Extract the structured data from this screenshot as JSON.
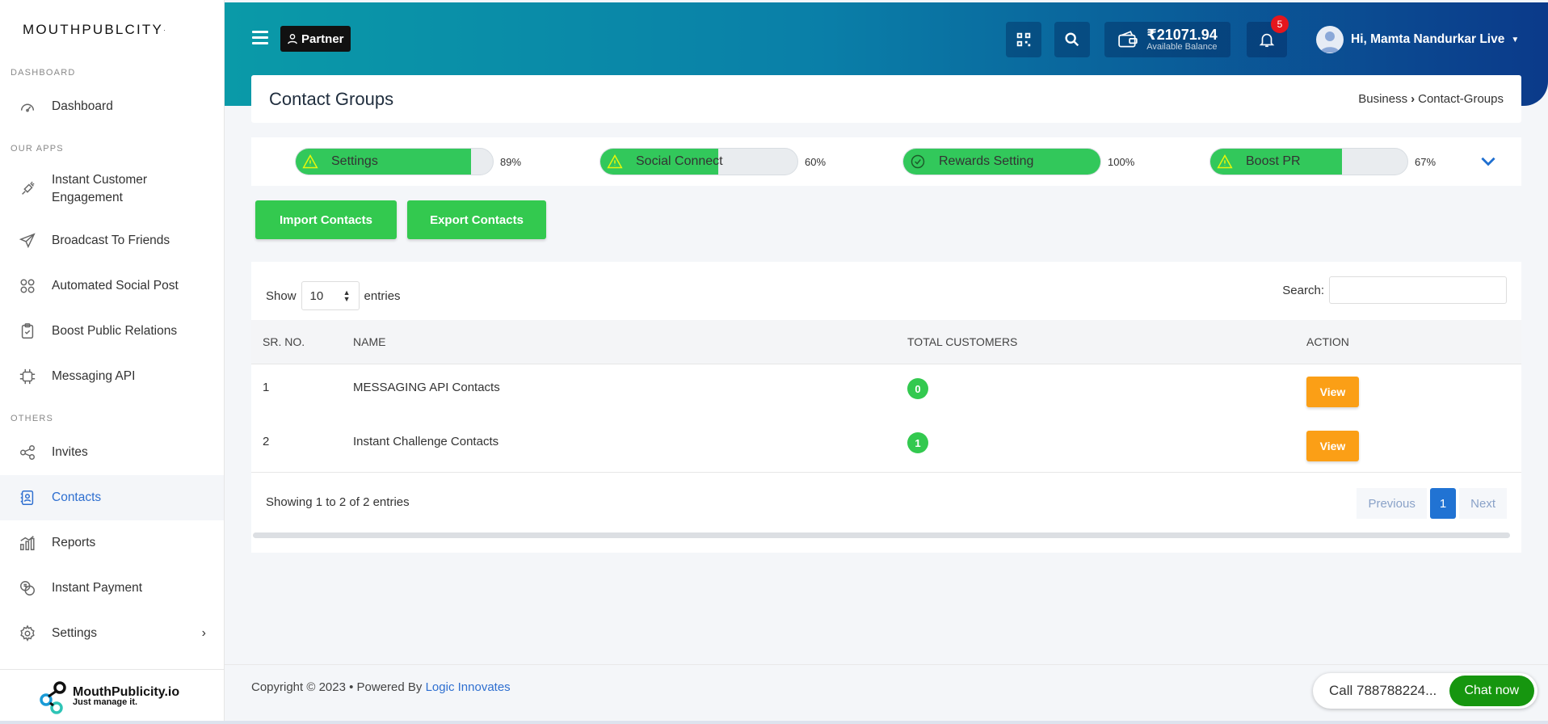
{
  "brand": {
    "name": "MOUTHPUBLCITY",
    "mark": "·"
  },
  "sidebar": {
    "sections": [
      "DASHBOARD",
      "OUR APPS",
      "OTHERS"
    ],
    "items": [
      {
        "label": "Dashboard",
        "icon": "speedometer-icon"
      },
      {
        "label": "Instant Customer Engagement",
        "icon": "megaphone-icon"
      },
      {
        "label": "Broadcast To Friends",
        "icon": "send-icon"
      },
      {
        "label": "Automated Social Post",
        "icon": "apps-icon"
      },
      {
        "label": "Boost Public Relations",
        "icon": "clipboard-icon"
      },
      {
        "label": "Messaging API",
        "icon": "api-icon"
      },
      {
        "label": "Invites",
        "icon": "share-icon"
      },
      {
        "label": "Contacts",
        "icon": "contact-book-icon",
        "active": true
      },
      {
        "label": "Reports",
        "icon": "bar-chart-icon"
      },
      {
        "label": "Instant Payment",
        "icon": "coins-icon"
      },
      {
        "label": "Settings",
        "icon": "gear-icon"
      }
    ],
    "footer": {
      "line1": "MouthPublicity.io",
      "line2": "Just manage it."
    }
  },
  "header": {
    "partner_label": "Partner",
    "balance": "₹21071.94",
    "balance_label": "Available Balance",
    "notifications": "5",
    "user_greeting": "Hi, Mamta Nandurkar Live"
  },
  "page": {
    "title": "Contact Groups",
    "breadcrumb": [
      "Business",
      "Contact-Groups"
    ]
  },
  "progress": [
    {
      "label": "Settings",
      "percent": 89,
      "percent_text": "89%",
      "status": "warning"
    },
    {
      "label": "Social Connect",
      "percent": 60,
      "percent_text": "60%",
      "status": "warning"
    },
    {
      "label": "Rewards Setting",
      "percent": 100,
      "percent_text": "100%",
      "status": "complete"
    },
    {
      "label": "Boost PR",
      "percent": 67,
      "percent_text": "67%",
      "status": "warning"
    }
  ],
  "actions": {
    "import": "Import Contacts",
    "export": "Export Contacts"
  },
  "table": {
    "show_label": "Show",
    "page_size": "10",
    "entries_label": "entries",
    "search_label": "Search:",
    "columns": [
      "SR. NO.",
      "NAME",
      "TOTAL CUSTOMERS",
      "ACTION"
    ],
    "rows": [
      {
        "sr": "1",
        "name": "MESSAGING API Contacts",
        "total": "0",
        "action": "View"
      },
      {
        "sr": "2",
        "name": "Instant Challenge Contacts",
        "total": "1",
        "action": "View"
      }
    ],
    "info": "Showing 1 to 2 of 2 entries",
    "pagination": {
      "previous": "Previous",
      "current": "1",
      "next": "Next"
    }
  },
  "footer": {
    "copyright": "Copyright © 2023  • Powered By ",
    "link": "Logic Innovates"
  },
  "chat": {
    "call": "Call 788788224...",
    "button": "Chat now"
  },
  "colors": {
    "accent": "#2e6fd0",
    "green": "#33c94f",
    "orange": "#fb9f16",
    "header_start": "#0a9aa8",
    "header_end": "#0b3a8a"
  }
}
